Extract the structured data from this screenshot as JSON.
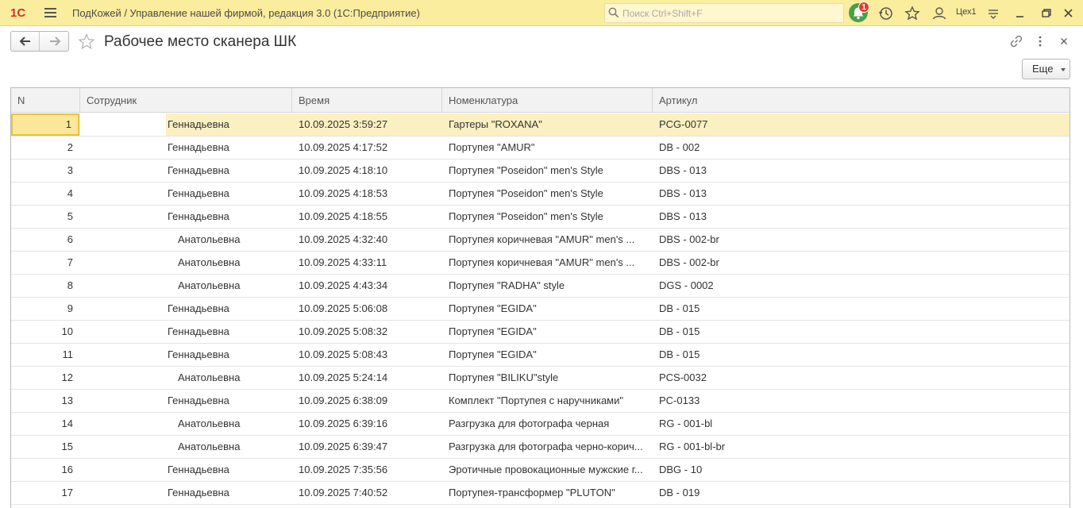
{
  "app": {
    "logo_text": "1С",
    "title": "ПодКожей / Управление нашей фирмой, редакция 3.0  (1С:Предприятие)",
    "search_placeholder": "Поиск Ctrl+Shift+F",
    "notification_count": "1",
    "user": "Цех1",
    "accent_color": "#fbed9e"
  },
  "form": {
    "title": "Рабочее место сканера ШК",
    "more_button": "Еще"
  },
  "table": {
    "columns": {
      "n": "N",
      "employee": "Сотрудник",
      "time": "Время",
      "nomenclature": "Номенклатура",
      "article": "Артикул"
    },
    "rows": [
      {
        "n": "1",
        "employee": "Геннадьевна",
        "time": "10.09.2025 3:59:27",
        "nomenclature": "Гартеры \"ROXANA\"",
        "article": "PCG-0077",
        "selected": true
      },
      {
        "n": "2",
        "employee": "Геннадьевна",
        "time": "10.09.2025 4:17:52",
        "nomenclature": "Портупея \"AMUR\"",
        "article": "DB - 002"
      },
      {
        "n": "3",
        "employee": "Геннадьевна",
        "time": "10.09.2025 4:18:10",
        "nomenclature": "Портупея \"Poseidon\"  men's Style",
        "article": "DBS - 013"
      },
      {
        "n": "4",
        "employee": "Геннадьевна",
        "time": "10.09.2025 4:18:53",
        "nomenclature": "Портупея \"Poseidon\"  men's Style",
        "article": "DBS - 013"
      },
      {
        "n": "5",
        "employee": "Геннадьевна",
        "time": "10.09.2025 4:18:55",
        "nomenclature": "Портупея \"Poseidon\"  men's Style",
        "article": "DBS - 013"
      },
      {
        "n": "6",
        "employee": "Анатольевна",
        "time": "10.09.2025 4:32:40",
        "nomenclature": "Портупея коричневая \"AMUR\"  men's ...",
        "article": "DBS - 002-br"
      },
      {
        "n": "7",
        "employee": "Анатольевна",
        "time": "10.09.2025 4:33:11",
        "nomenclature": "Портупея коричневая \"AMUR\"  men's ...",
        "article": "DBS - 002-br"
      },
      {
        "n": "8",
        "employee": "Анатольевна",
        "time": "10.09.2025 4:43:34",
        "nomenclature": "Портупея \"RADHA\" style",
        "article": "DGS - 0002"
      },
      {
        "n": "9",
        "employee": "Геннадьевна",
        "time": "10.09.2025 5:06:08",
        "nomenclature": "Портупея \"EGIDA\"",
        "article": "DB - 015"
      },
      {
        "n": "10",
        "employee": "Геннадьевна",
        "time": "10.09.2025 5:08:32",
        "nomenclature": "Портупея \"EGIDA\"",
        "article": "DB - 015"
      },
      {
        "n": "11",
        "employee": "Геннадьевна",
        "time": "10.09.2025 5:08:43",
        "nomenclature": "Портупея \"EGIDA\"",
        "article": "DB - 015"
      },
      {
        "n": "12",
        "employee": "Анатольевна",
        "time": "10.09.2025 5:24:14",
        "nomenclature": "Портупея  \"BILIKU\"style",
        "article": "PCS-0032"
      },
      {
        "n": "13",
        "employee": "Геннадьевна",
        "time": "10.09.2025 6:38:09",
        "nomenclature": "Комплект \"Портупея с наручниками\"",
        "article": "PC-0133"
      },
      {
        "n": "14",
        "employee": "Анатольевна",
        "time": "10.09.2025 6:39:16",
        "nomenclature": "Разгрузка для фотографа черная",
        "article": "RG - 001-bl"
      },
      {
        "n": "15",
        "employee": "Анатольевна",
        "time": "10.09.2025 6:39:47",
        "nomenclature": "Разгрузка для фотографа черно-корич...",
        "article": "RG - 001-bl-br"
      },
      {
        "n": "16",
        "employee": "Геннадьевна",
        "time": "10.09.2025 7:35:56",
        "nomenclature": "Эротичные провокационные мужские г...",
        "article": "DBG - 10"
      },
      {
        "n": "17",
        "employee": "Геннадьевна",
        "time": "10.09.2025 7:40:52",
        "nomenclature": "Портупея-трансформер \"PLUTON\"",
        "article": "DB - 019"
      }
    ]
  }
}
